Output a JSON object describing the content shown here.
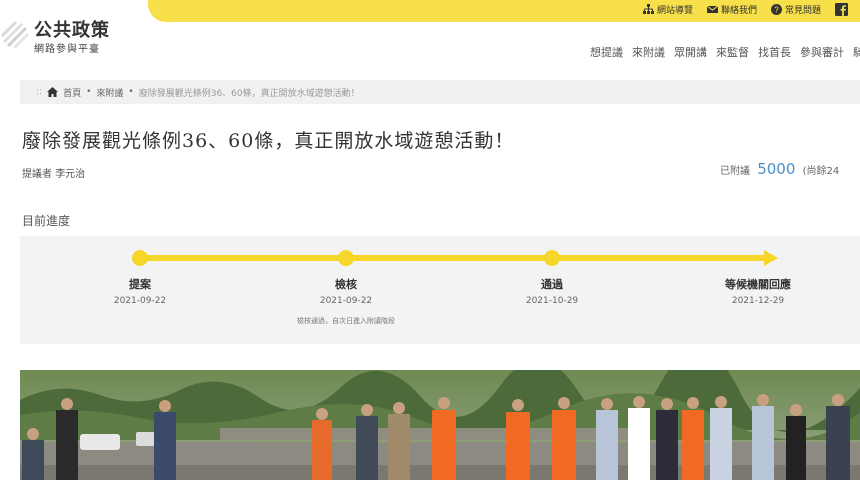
{
  "header": {
    "logo_title": "公共政策",
    "logo_subtitle": "網路參與平臺",
    "top_links": [
      {
        "label": "網站導覽",
        "icon": "sitemap-icon"
      },
      {
        "label": "聯絡我們",
        "icon": "mail-icon"
      },
      {
        "label": "常見問題",
        "icon": "help-icon"
      }
    ],
    "facebook_icon": "facebook-icon",
    "nav": [
      "想提議",
      "來附議",
      "眾開講",
      "來監督",
      "找首長",
      "參與審計",
      "騎"
    ]
  },
  "breadcrumb": {
    "home": "首頁",
    "section": "來附議",
    "current": "廢除發展觀光條例36、60條，真正開放水域遊憩活動！"
  },
  "proposal": {
    "title": "廢除發展觀光條例36、60條，真正開放水域遊憩活動！",
    "proposer_label": "提議者",
    "proposer_name": "李元治",
    "signed_label": "已附議",
    "signed_count": "5000",
    "signed_suffix": "(尚餘24"
  },
  "progress": {
    "label": "目前進度",
    "stages": [
      {
        "name": "提案",
        "date": "2021-09-22",
        "note": ""
      },
      {
        "name": "檢核",
        "date": "2021-09-22",
        "note": "檢核通過，自次日進入附議階段"
      },
      {
        "name": "通過",
        "date": "2021-10-29",
        "note": ""
      },
      {
        "name": "等候機關回應",
        "date": "2021-12-29",
        "note": ""
      }
    ]
  },
  "colors": {
    "brand_yellow": "#f7e04a",
    "timeline_yellow": "#f5d629",
    "signed_blue": "#4a90c9"
  }
}
